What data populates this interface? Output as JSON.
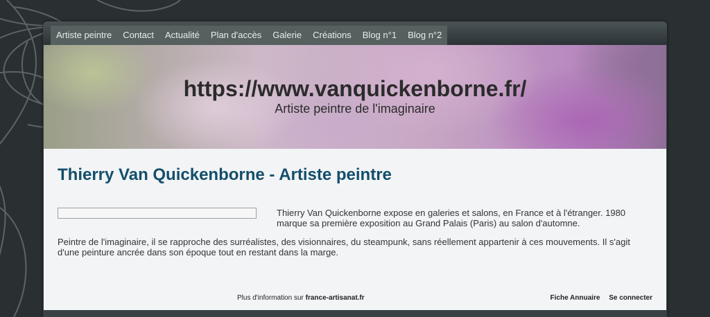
{
  "nav": {
    "items": [
      {
        "label": "Artiste peintre"
      },
      {
        "label": "Contact"
      },
      {
        "label": "Actualité"
      },
      {
        "label": "Plan d'accès"
      },
      {
        "label": "Galerie"
      },
      {
        "label": "Créations"
      },
      {
        "label": "Blog n°1"
      },
      {
        "label": "Blog n°2"
      }
    ]
  },
  "header": {
    "site_title": "https://www.vanquickenborne.fr/",
    "site_subtitle": "Artiste peintre de l'imaginaire"
  },
  "main": {
    "page_title": "Thierry Van Quickenborne - Artiste peintre",
    "intro_text": "Thierry Van Quickenborne expose en galeries et salons, en France et à l'étranger. 1980 marque sa première exposition au Grand Palais (Paris) au salon d'automne.",
    "paragraph_2": " Peintre de l'imaginaire, il se rapproche des surréalistes, des visionnaires, du steampunk, sans réellement appartenir à ces mouvements. Il s'agit d'une peinture ancrée dans son époque tout en restant dans la marge."
  },
  "footer": {
    "more_info_prefix": "Plus d'information sur ",
    "more_info_link": "france-artisanat.fr",
    "annuaire_link": "Fiche Annuaire",
    "login_link": "Se connecter"
  },
  "colors": {
    "title_blue": "#134e6b",
    "nav_bg": "#55605f",
    "page_bg": "#2a2f32"
  }
}
